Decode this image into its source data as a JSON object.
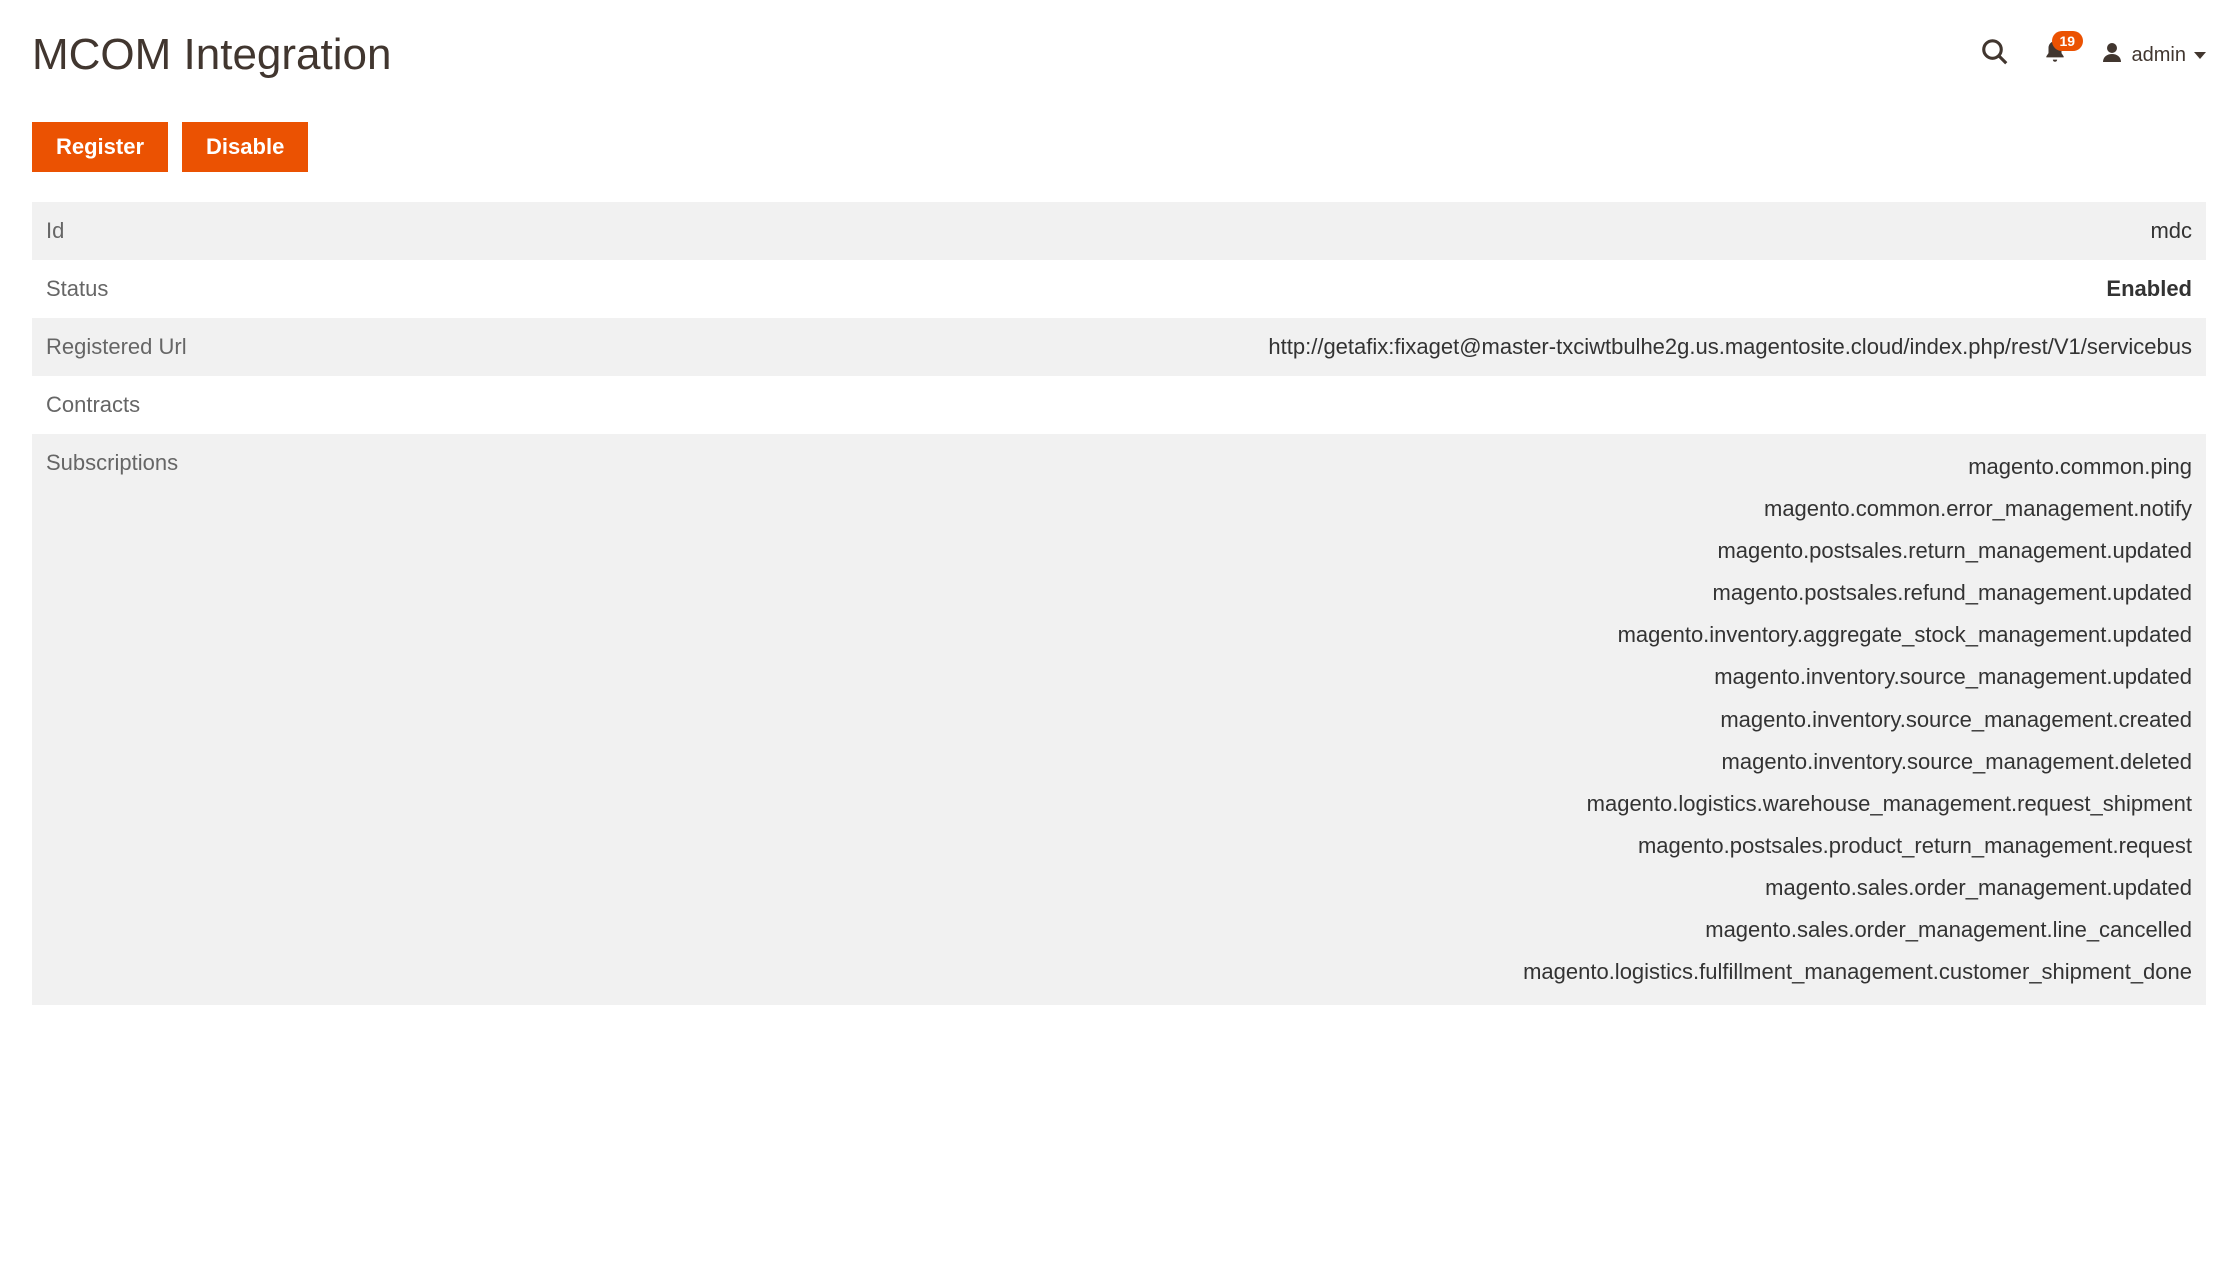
{
  "header": {
    "title": "MCOM Integration",
    "notification_count": "19",
    "user_name": "admin"
  },
  "actions": {
    "register_label": "Register",
    "disable_label": "Disable"
  },
  "labels": {
    "id": "Id",
    "status": "Status",
    "registered_url": "Registered Url",
    "contracts": "Contracts",
    "subscriptions": "Subscriptions"
  },
  "values": {
    "id": "mdc",
    "status": "Enabled",
    "registered_url": "http://getafix:fixaget@master-txciwtbulhe2g.us.magentosite.cloud/index.php/rest/V1/servicebus",
    "contracts": ""
  },
  "subscriptions": [
    "magento.common.ping",
    "magento.common.error_management.notify",
    "magento.postsales.return_management.updated",
    "magento.postsales.refund_management.updated",
    "magento.inventory.aggregate_stock_management.updated",
    "magento.inventory.source_management.updated",
    "magento.inventory.source_management.created",
    "magento.inventory.source_management.deleted",
    "magento.logistics.warehouse_management.request_shipment",
    "magento.postsales.product_return_management.request",
    "magento.sales.order_management.updated",
    "magento.sales.order_management.line_cancelled",
    "magento.logistics.fulfillment_management.customer_shipment_done"
  ]
}
